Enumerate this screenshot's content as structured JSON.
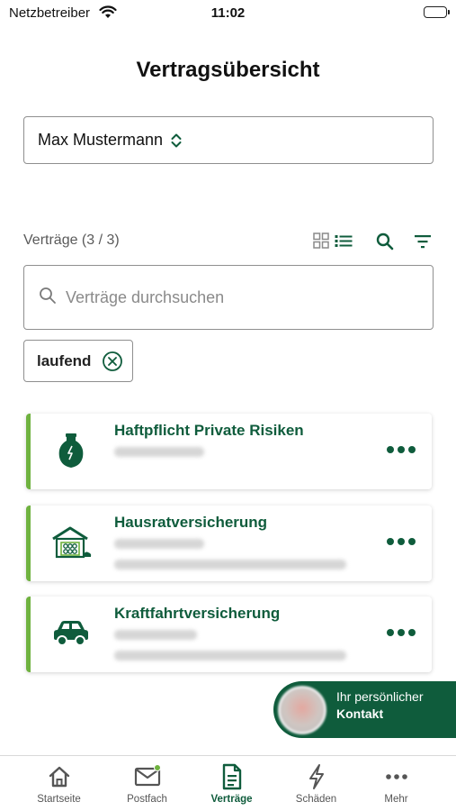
{
  "status_bar": {
    "carrier": "Netzbetreiber",
    "time": "11:02"
  },
  "header": {
    "title": "Vertragsübersicht"
  },
  "person_selector": {
    "value": "Max Mustermann"
  },
  "contracts": {
    "count_label": "Verträge (3 / 3)",
    "search_placeholder": "Verträge durchsuchen",
    "filter_chip": "laufend",
    "items": [
      {
        "title": "Haftpflicht Private Risiken",
        "icon": "vase-icon"
      },
      {
        "title": "Hausratversicherung",
        "icon": "house-icon"
      },
      {
        "title": "Kraftfahrtversicherung",
        "icon": "car-icon"
      }
    ]
  },
  "contact": {
    "line1": "Ihr persönlicher",
    "line2": "Kontakt"
  },
  "tab_bar": {
    "items": [
      {
        "label": "Startseite",
        "icon": "home-icon"
      },
      {
        "label": "Postfach",
        "icon": "mail-icon"
      },
      {
        "label": "Verträge",
        "icon": "document-icon"
      },
      {
        "label": "Schäden",
        "icon": "lightning-icon"
      },
      {
        "label": "Mehr",
        "icon": "more-icon"
      }
    ],
    "active_index": 2
  },
  "colors": {
    "brand_green": "#0f5c3c",
    "accent_green": "#6fb23f"
  }
}
